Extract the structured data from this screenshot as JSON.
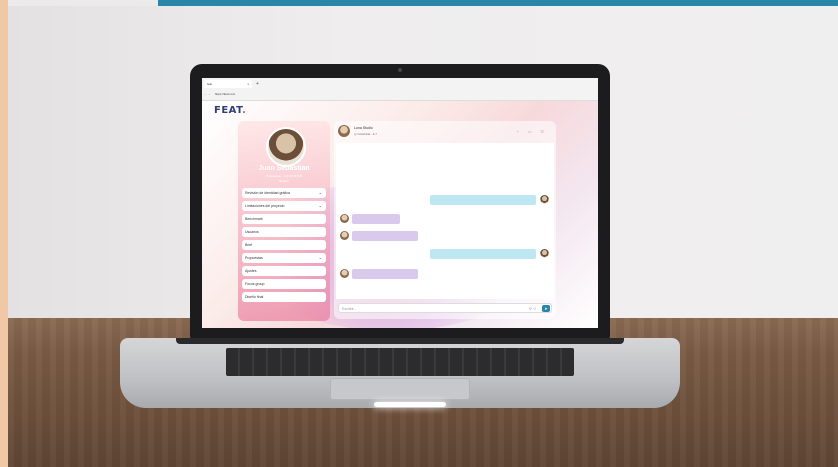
{
  "browser": {
    "tab_label": "feat",
    "tab_close": "x",
    "new_tab": "+",
    "nav": "← →",
    "url": "https://feat.com"
  },
  "app": {
    "logo": "FEAT",
    "logo_dot": ".",
    "profile": {
      "name": "Juan Sebastian",
      "meta": "Propuestas · 4.8 ★★★★★",
      "sub": "Bogotá"
    },
    "menu": [
      {
        "label": "Revisión de identidad gráfica",
        "chevron": "⌄"
      },
      {
        "label": "Limitaciones del proyecto",
        "chevron": "⌄"
      },
      {
        "label": "Benchmark",
        "chevron": ""
      },
      {
        "label": "Usuarios",
        "chevron": ""
      },
      {
        "label": "Brief",
        "chevron": ""
      },
      {
        "label": "Propuestas",
        "chevron": "⌄"
      },
      {
        "label": "Ajustes",
        "chevron": ""
      },
      {
        "label": "Focus group",
        "chevron": ""
      },
      {
        "label": "Diseño final",
        "chevron": ""
      }
    ],
    "chat": {
      "contact_name": "Luna Studio",
      "contact_location": "◎ Colombia · 4.7",
      "header_icons": "+ ▭ ✆",
      "input_placeholder": "Escribir...",
      "attach_icons": "⚲ ☺",
      "send_icon": "➤"
    }
  }
}
